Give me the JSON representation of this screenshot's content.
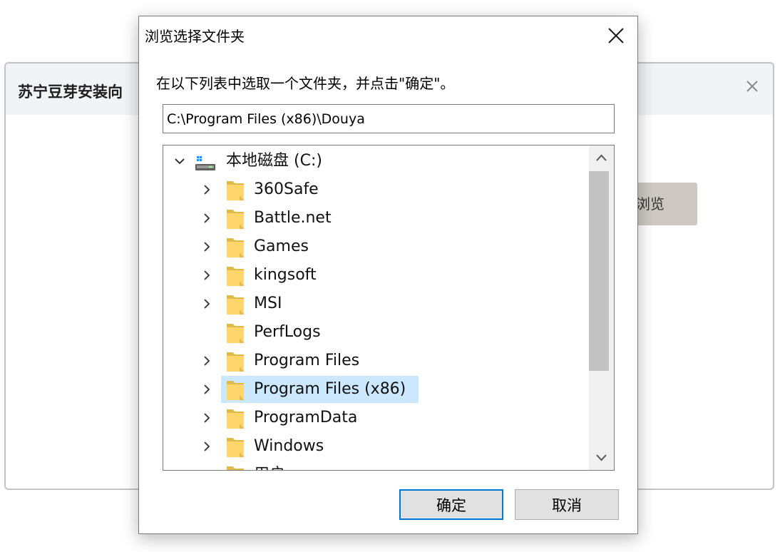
{
  "background_window": {
    "title": "苏宁豆芽安装向",
    "close_icon": "close-icon",
    "browse_button_label": "浏览",
    "colors": {
      "header_bg": "#f2f3f6",
      "browse_bg": "#cdc9c2"
    }
  },
  "dialog": {
    "title": "浏览选择文件夹",
    "close_icon": "close-icon",
    "instruction": "在以下列表中选取一个文件夹，并点击\"确定\"。",
    "path_value": "C:\\Program Files (x86)\\Douya",
    "tree": {
      "root": {
        "label": "本地磁盘 (C:)",
        "icon": "drive-icon",
        "expanded": true
      },
      "items": [
        {
          "label": "360Safe",
          "has_children": true,
          "selected": false
        },
        {
          "label": "Battle.net",
          "has_children": true,
          "selected": false
        },
        {
          "label": "Games",
          "has_children": true,
          "selected": false
        },
        {
          "label": "kingsoft",
          "has_children": true,
          "selected": false
        },
        {
          "label": "MSI",
          "has_children": true,
          "selected": false
        },
        {
          "label": "PerfLogs",
          "has_children": false,
          "selected": false
        },
        {
          "label": "Program Files",
          "has_children": true,
          "selected": false
        },
        {
          "label": "Program Files (x86)",
          "has_children": true,
          "selected": true
        },
        {
          "label": "ProgramData",
          "has_children": true,
          "selected": false
        },
        {
          "label": "Windows",
          "has_children": true,
          "selected": false
        },
        {
          "label": "用户",
          "has_children": true,
          "selected": false
        }
      ]
    },
    "ok_label": "确定",
    "cancel_label": "取消",
    "colors": {
      "selection": "#cce8ff",
      "focus_border": "#0078d7",
      "folder": "#ffd66b"
    }
  }
}
